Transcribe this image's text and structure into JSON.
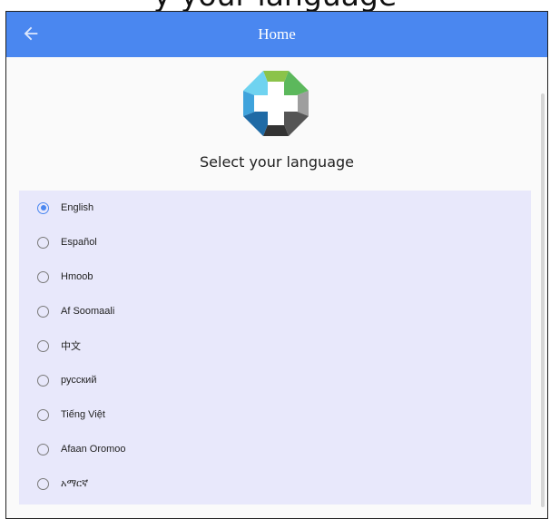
{
  "top_text": "y your language",
  "header": {
    "title": "Home",
    "back_icon": "arrow-left-icon",
    "color": "#4a87f0"
  },
  "logo": {
    "icon": "app-logo-icon"
  },
  "heading": "Select your language",
  "languages": [
    {
      "label": "English",
      "selected": true
    },
    {
      "label": "Español",
      "selected": false
    },
    {
      "label": "Hmoob",
      "selected": false
    },
    {
      "label": "Af Soomaali",
      "selected": false
    },
    {
      "label": "中文",
      "selected": false
    },
    {
      "label": "русский",
      "selected": false
    },
    {
      "label": "Tiếng Việt",
      "selected": false
    },
    {
      "label": "Afaan Oromoo",
      "selected": false
    },
    {
      "label": "አማርኛ",
      "selected": false
    }
  ],
  "colors": {
    "panel": "#e8e8fb",
    "accent": "#4a87f0"
  }
}
